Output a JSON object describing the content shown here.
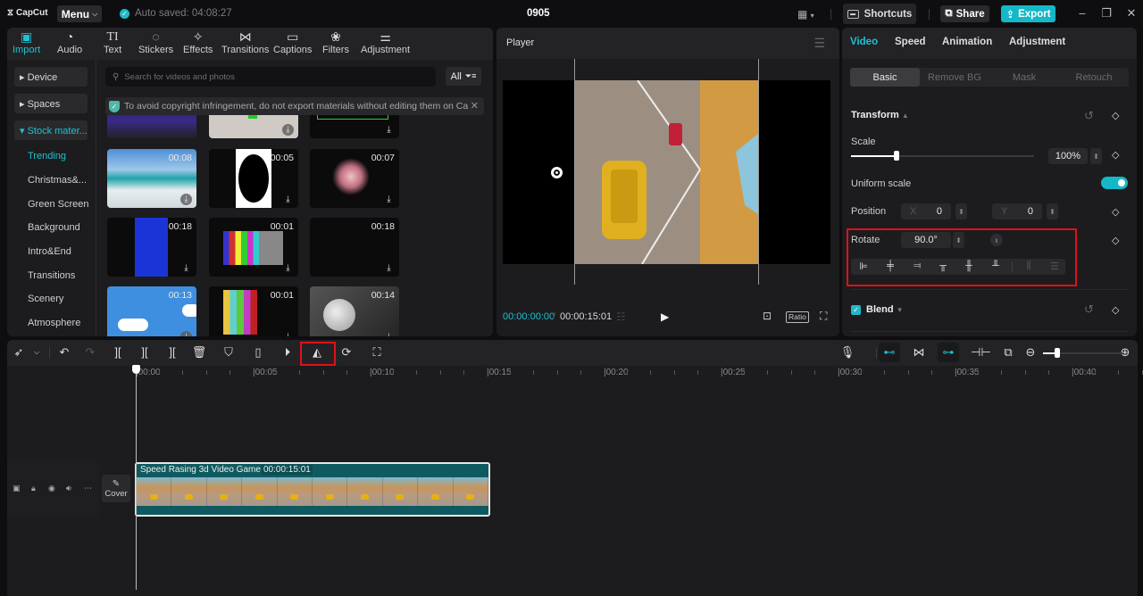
{
  "app": {
    "logo": "CapCut",
    "menu_label": "Menu",
    "autosave": "Auto saved: 04:08:27",
    "project_title": "0905",
    "shortcuts_label": "Shortcuts",
    "share_label": "Share",
    "export_label": "Export"
  },
  "media": {
    "tabs": [
      {
        "label": "Import",
        "icon": "import-icon",
        "glyph": "▣"
      },
      {
        "label": "Audio",
        "icon": "audio-icon",
        "glyph": "◔"
      },
      {
        "label": "Text",
        "icon": "text-icon",
        "glyph": "TI"
      },
      {
        "label": "Stickers",
        "icon": "stickers-icon",
        "glyph": "◌"
      },
      {
        "label": "Effects",
        "icon": "effects-icon",
        "glyph": "✧"
      },
      {
        "label": "Transitions",
        "icon": "transitions-icon",
        "glyph": "⋈"
      },
      {
        "label": "Captions",
        "icon": "captions-icon",
        "glyph": "▭"
      },
      {
        "label": "Filters",
        "icon": "filters-icon",
        "glyph": "❀"
      },
      {
        "label": "Adjustment",
        "icon": "adjustment-icon",
        "glyph": "⚌"
      }
    ],
    "nav_groups": [
      {
        "label": "▸ Device"
      },
      {
        "label": "▸ Spaces"
      },
      {
        "label": "▾ Stock mater..."
      }
    ],
    "nav_items": [
      "Trending",
      "Christmas&...",
      "Green Screen",
      "Background",
      "Intro&End",
      "Transitions",
      "Scenery",
      "Atmosphere"
    ],
    "search_placeholder": "Search for videos and photos",
    "filter_label": "All",
    "notice": "To avoid copyright infringement, do not export materials without editing them on Ca",
    "thumbnails": [
      {
        "duration": "",
        "name": "city-night-lights"
      },
      {
        "duration": "",
        "name": "green-screen-wood"
      },
      {
        "duration": "",
        "name": "green-progress-bar"
      },
      {
        "duration": "00:08",
        "name": "beach-waves"
      },
      {
        "duration": "00:05",
        "name": "circle-overlay"
      },
      {
        "duration": "00:07",
        "name": "firework"
      },
      {
        "duration": "00:18",
        "name": "blue-screen"
      },
      {
        "duration": "00:01",
        "name": "tv-test-pattern"
      },
      {
        "duration": "00:18",
        "name": "black-screen"
      },
      {
        "duration": "00:13",
        "name": "blue-sky-clouds"
      },
      {
        "duration": "00:01",
        "name": "color-bars"
      },
      {
        "duration": "00:14",
        "name": "full-moon"
      }
    ]
  },
  "player": {
    "title": "Player",
    "current_time": "00:00:00:00",
    "separator": "/",
    "total_time": "00:00:15:01",
    "ratio_label": "Ratio"
  },
  "properties": {
    "tabs": [
      "Video",
      "Speed",
      "Animation",
      "Adjustment"
    ],
    "subtabs": [
      "Basic",
      "Remove BG",
      "Mask",
      "Retouch"
    ],
    "transform_title": "Transform",
    "scale_label": "Scale",
    "scale_value": "100%",
    "scale_percent": 100,
    "uniform_scale_label": "Uniform scale",
    "uniform_scale_on": true,
    "position_label": "Position",
    "position_x_label": "X",
    "position_x": "0",
    "position_y_label": "Y",
    "position_y": "0",
    "rotate_label": "Rotate",
    "rotate_value": "90.0°",
    "blend_label": "Blend",
    "blend_checked": true
  },
  "timeline": {
    "ruler": [
      "00:00",
      "00:05",
      "00:10",
      "00:15",
      "00:20",
      "00:25",
      "00:30",
      "00:35",
      "00:40"
    ],
    "cover_label": "Cover",
    "clip_title": "Speed Rasing 3d Video Game",
    "clip_duration": "00:00:15:01"
  },
  "colors": {
    "accent": "#1fc1d2",
    "export": "#14b8c8",
    "highlight_box": "#e0101a",
    "clip": "#0e5a60"
  }
}
